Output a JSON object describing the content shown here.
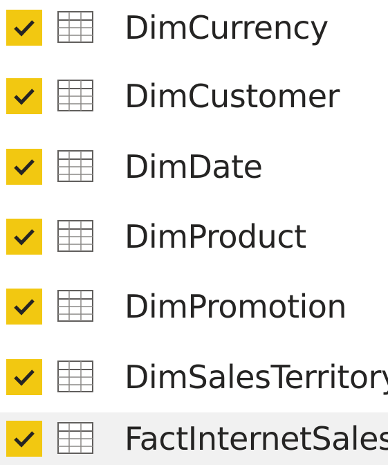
{
  "accent_color": "#f2c811",
  "tables": [
    {
      "name": "DimCurrency",
      "checked": true,
      "icon": "table-icon"
    },
    {
      "name": "DimCustomer",
      "checked": true,
      "icon": "table-icon"
    },
    {
      "name": "DimDate",
      "checked": true,
      "icon": "table-icon"
    },
    {
      "name": "DimProduct",
      "checked": true,
      "icon": "table-icon"
    },
    {
      "name": "DimPromotion",
      "checked": true,
      "icon": "table-icon"
    },
    {
      "name": "DimSalesTerritory",
      "checked": true,
      "icon": "table-icon"
    },
    {
      "name": "FactInternetSales",
      "checked": true,
      "icon": "table-icon"
    }
  ]
}
